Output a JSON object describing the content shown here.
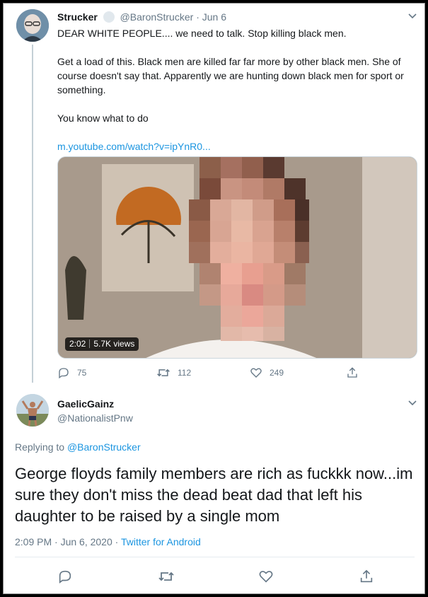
{
  "parent_tweet": {
    "display_name": "Strucker",
    "handle": "@BaronStrucker",
    "separator": "·",
    "date": "Jun 6",
    "text_lines": [
      "DEAR WHITE PEOPLE.... we need to talk. Stop killing black men.",
      "Get a load of this. Black men are killed far far more by other black men. She of course doesn't say that. Apparently we are hunting down black men for sport or something.",
      "You know what to do"
    ],
    "link": "m.youtube.com/watch?v=ipYnR0...",
    "video": {
      "duration": "2:02",
      "views": "5.7K views"
    },
    "actions": {
      "replies": "75",
      "retweets": "112",
      "likes": "249"
    }
  },
  "reply_tweet": {
    "display_name": "GaelicGainz",
    "handle": "@NationalistPnw",
    "replying_prefix": "Replying to",
    "replying_to": "@BaronStrucker",
    "text": "George floyds family members are rich as fuckkk now...im sure they don't miss the dead beat dad that left his daughter to be raised by a single mom",
    "timestamp": "2:09 PM · Jun 6, 2020 ·",
    "source": "Twitter for Android"
  },
  "icons": [
    "reply-icon",
    "retweet-icon",
    "like-icon",
    "share-icon",
    "chevron-down-icon",
    "verified-icon"
  ],
  "colors": {
    "link": "#1b95e0",
    "secondary_text": "#657786",
    "thread_line": "#c4cfd6"
  }
}
